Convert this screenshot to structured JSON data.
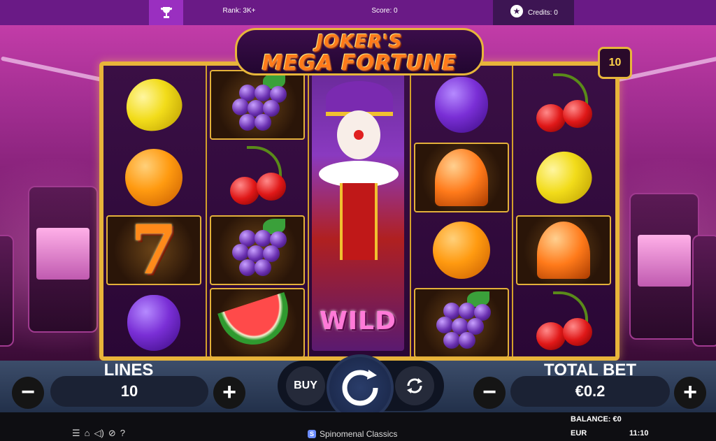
{
  "topbar": {
    "rank": "Rank: 3K+",
    "score": "Score: 0",
    "credits": "Credits: 0"
  },
  "game": {
    "title_line1": "JOKER'S",
    "title_line2": "MEGA FORTUNE",
    "lines_badge": "10",
    "wild_label": "WILD"
  },
  "reels": [
    [
      "lemon",
      "orange",
      "seven",
      "plum"
    ],
    [
      "grapes",
      "cherry",
      "grapes",
      "watermelon"
    ],
    [
      "joker-wild"
    ],
    [
      "plum",
      "bell",
      "orange",
      "grapes"
    ],
    [
      "cherry",
      "lemon",
      "bell",
      "cherry"
    ]
  ],
  "controls": {
    "lines_label": "LINES",
    "lines_value": "10",
    "total_bet_label": "TOTAL BET",
    "total_bet_value": "€0.2",
    "buy_label": "BUY",
    "minus": "−",
    "plus": "+"
  },
  "status": {
    "brand": "Spinomenal Classics",
    "balance": "BALANCE:  €0",
    "currency": "EUR",
    "time": "11:10"
  },
  "colors": {
    "frame_gold": "#e8b43a",
    "topbar_purple": "#6a1a86",
    "controls_bg": "#3c4d6a"
  }
}
